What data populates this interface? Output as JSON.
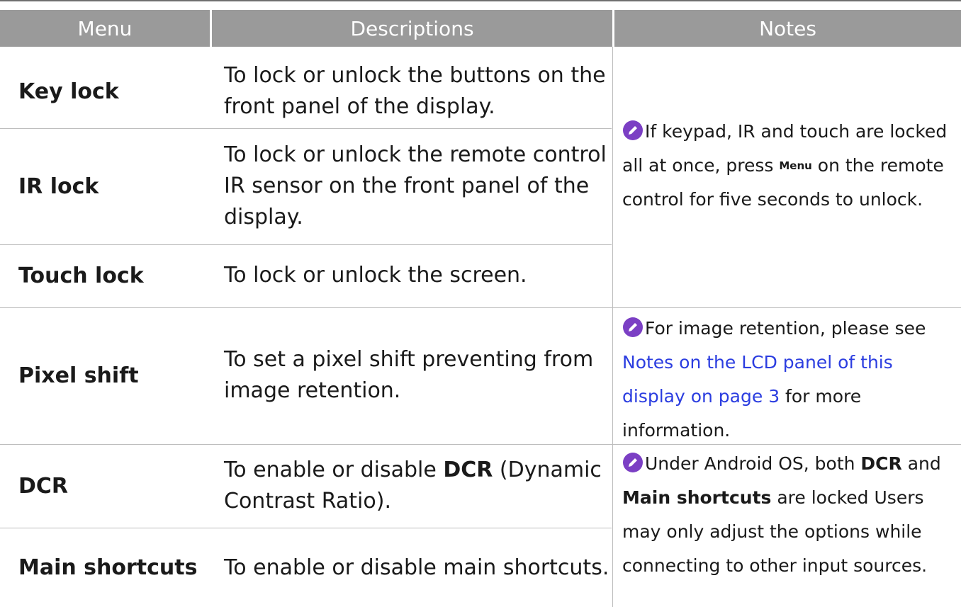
{
  "header": {
    "menu": "Menu",
    "descriptions": "Descriptions",
    "notes": "Notes"
  },
  "rows": [
    {
      "menu": "Key lock",
      "desc": "To lock or unlock the buttons on the front panel of the display."
    },
    {
      "menu": "IR lock",
      "desc": "To lock or unlock the remote control IR sensor on the front panel of the display."
    },
    {
      "menu": "Touch lock",
      "desc": "To lock or unlock the screen."
    },
    {
      "menu": "Pixel shift",
      "desc": "To set a pixel shift preventing from image retention."
    },
    {
      "menu": "DCR",
      "desc_pre": "To enable or disable ",
      "desc_bold": "DCR",
      "desc_post": " (Dynamic Contrast Ratio)."
    },
    {
      "menu": "Main shortcuts",
      "desc": "To enable or disable main shortcuts."
    }
  ],
  "notes": {
    "lock": {
      "pre": "If keypad, IR and touch are locked all at once, press ",
      "key": "Menu",
      "post": " on the remote control for five seconds to unlock."
    },
    "pixel": {
      "pre": "For image retention, please see ",
      "link": "Notes on the LCD panel of this display on page 3",
      "post": " for more information."
    },
    "dcr": {
      "pre": "Under Android OS, both ",
      "b1": "DCR",
      "mid": " and ",
      "b2": "Main shortcuts",
      "post": " are locked Users may only adjust the options while connecting to other input sources."
    }
  },
  "icons": {
    "note": "pencil-note-icon"
  },
  "colors": {
    "header_bg": "#9a9a9a",
    "icon_purple": "#7b3fc4",
    "link": "#2b3de0"
  }
}
